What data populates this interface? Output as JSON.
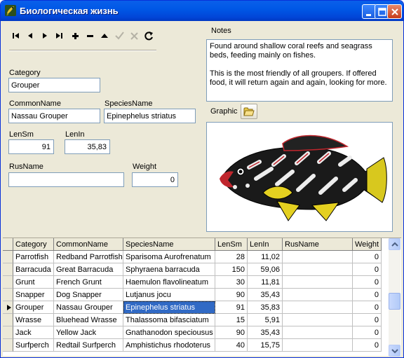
{
  "window": {
    "title": "Биологическая жизнь",
    "icon": "fish-app-icon",
    "controls": [
      "minimize-icon",
      "maximize-icon",
      "close-icon"
    ]
  },
  "navigator": {
    "buttons": [
      {
        "icon": "first-record-icon",
        "enabled": true
      },
      {
        "icon": "prior-record-icon",
        "enabled": true
      },
      {
        "icon": "next-record-icon",
        "enabled": true
      },
      {
        "icon": "last-record-icon",
        "enabled": true
      },
      {
        "icon": "insert-record-icon",
        "enabled": true
      },
      {
        "icon": "delete-record-icon",
        "enabled": true
      },
      {
        "icon": "edit-record-icon",
        "enabled": true
      },
      {
        "icon": "post-edit-icon",
        "enabled": false
      },
      {
        "icon": "cancel-edit-icon",
        "enabled": false
      },
      {
        "icon": "refresh-data-icon",
        "enabled": true
      }
    ]
  },
  "form": {
    "category_label": "Category",
    "category_value": "Grouper",
    "commonname_label": "CommonName",
    "commonname_value": "Nassau Grouper",
    "speciesname_label": "SpeciesName",
    "speciesname_value": "Epinephelus striatus",
    "lensm_label": "LenSm",
    "lensm_value": "91",
    "lenin_label": "LenIn",
    "lenin_value": "35,83",
    "rusname_label": "RusName",
    "rusname_value": "",
    "weight_label": "Weight",
    "weight_value": "0",
    "notes_label": "Notes",
    "notes_paragraphs": [
      "Found around shallow coral reefs and seagrass beds, feeding mainly on fishes.",
      "This is the most friendly of all groupers.  If offered food, it will return again and again, looking for more."
    ],
    "graphic_label": "Graphic",
    "graphic_button_icon": "open-folder-icon",
    "graphic_image": "grouper-fish-picture"
  },
  "grid": {
    "columns": [
      "Category",
      "CommonName",
      "SpeciesName",
      "LenSm",
      "LenIn",
      "RusName",
      "Weight"
    ],
    "current_row_indicator": "current-row-arrow-icon",
    "rows": [
      {
        "category": "Parrotfish",
        "commonname": "Redband Parrotfish",
        "speciesname": "Sparisoma Aurofrenatum",
        "lensm": "28",
        "lenin": "11,02",
        "rusname": "",
        "weight": "0",
        "current": false
      },
      {
        "category": "Barracuda",
        "commonname": "Great Barracuda",
        "speciesname": "Sphyraena barracuda",
        "lensm": "150",
        "lenin": "59,06",
        "rusname": "",
        "weight": "0",
        "current": false
      },
      {
        "category": "Grunt",
        "commonname": "French Grunt",
        "speciesname": "Haemulon flavolineatum",
        "lensm": "30",
        "lenin": "11,81",
        "rusname": "",
        "weight": "0",
        "current": false
      },
      {
        "category": "Snapper",
        "commonname": "Dog Snapper",
        "speciesname": "Lutjanus jocu",
        "lensm": "90",
        "lenin": "35,43",
        "rusname": "",
        "weight": "0",
        "current": false
      },
      {
        "category": "Grouper",
        "commonname": "Nassau Grouper",
        "speciesname": "Epinephelus striatus",
        "lensm": "91",
        "lenin": "35,83",
        "rusname": "",
        "weight": "0",
        "current": true
      },
      {
        "category": "Wrasse",
        "commonname": "Bluehead Wrasse",
        "speciesname": "Thalassoma bifasciatum",
        "lensm": "15",
        "lenin": "5,91",
        "rusname": "",
        "weight": "0",
        "current": false
      },
      {
        "category": "Jack",
        "commonname": "Yellow Jack",
        "speciesname": "Gnathanodon speciousus",
        "lensm": "90",
        "lenin": "35,43",
        "rusname": "",
        "weight": "0",
        "current": false
      },
      {
        "category": "Surfperch",
        "commonname": "Redtail Surfperch",
        "speciesname": "Amphistichus rhodoterus",
        "lensm": "40",
        "lenin": "15,75",
        "rusname": "",
        "weight": "0",
        "current": false
      }
    ],
    "scrollbar": {
      "position_fraction": 0.55,
      "up_icon": "scroll-up-icon",
      "down_icon": "scroll-down-icon"
    }
  },
  "colors": {
    "titlebar": "#0058E6",
    "window_face": "#ECE9D8",
    "selection": "#316AC5",
    "field_border": "#7F9DB9"
  }
}
